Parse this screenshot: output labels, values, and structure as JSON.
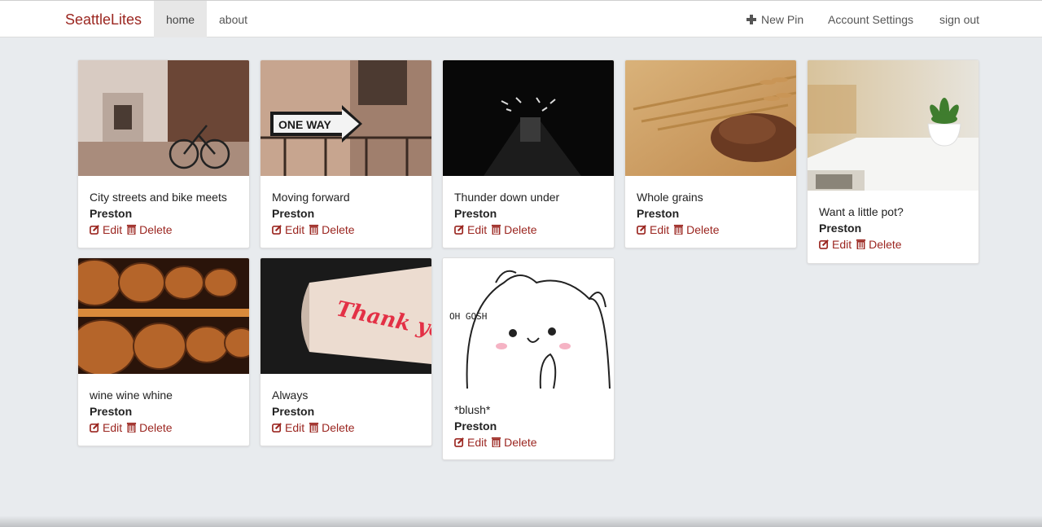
{
  "nav": {
    "brand": "SeattleLites",
    "links": [
      {
        "label": "home",
        "active": true
      },
      {
        "label": "about",
        "active": false
      }
    ],
    "right_links": [
      {
        "label": "New Pin",
        "icon": "plus-icon"
      },
      {
        "label": "Account Settings"
      },
      {
        "label": "sign out"
      }
    ]
  },
  "actions": {
    "edit_label": "Edit",
    "delete_label": "Delete"
  },
  "accent_color": "#9b2620",
  "pins": [
    {
      "title": "City streets and bike meets",
      "author": "Preston"
    },
    {
      "title": "Moving forward",
      "author": "Preston"
    },
    {
      "title": "Thunder down under",
      "author": "Preston"
    },
    {
      "title": "Whole grains",
      "author": "Preston"
    },
    {
      "title": "Want a little pot?",
      "author": "Preston"
    },
    {
      "title": "wine wine whine",
      "author": "Preston"
    },
    {
      "title": "Always",
      "author": "Preston"
    },
    {
      "title": "*blush*",
      "author": "Preston"
    }
  ],
  "image_text": {
    "sign": "ONE WAY",
    "neon": "Thank you!",
    "cartoon": "OH GOSH"
  }
}
